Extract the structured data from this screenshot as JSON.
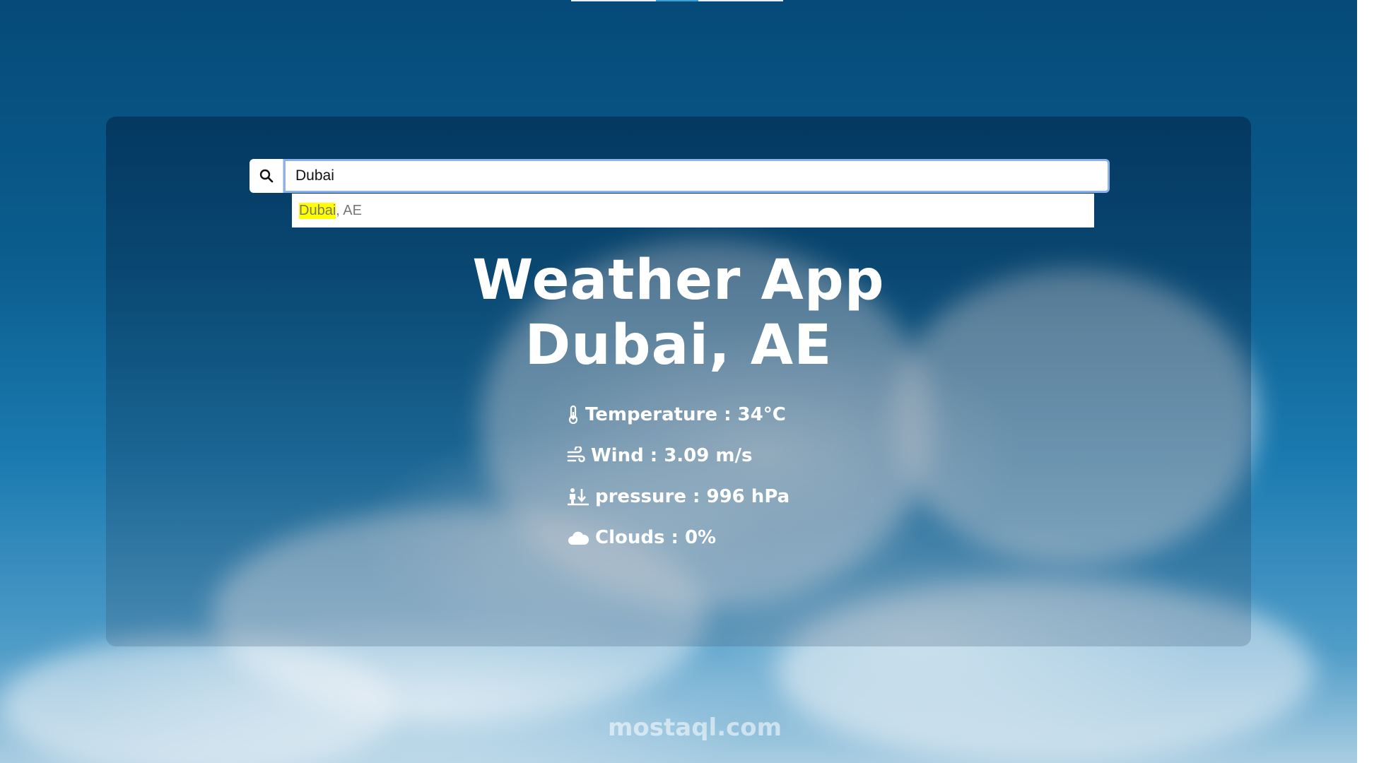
{
  "search": {
    "value": "Dubai",
    "suggestion_match": "Dubai",
    "suggestion_rest": ", AE"
  },
  "header": {
    "app_title": "Weather App",
    "city": "Dubai, AE"
  },
  "stats": [
    {
      "icon": "thermometer-icon",
      "label": "Temperature : 34°C"
    },
    {
      "icon": "wind-icon",
      "label": "Wind : 3.09 m/s"
    },
    {
      "icon": "pressure-icon",
      "label": "pressure : 996 hPa"
    },
    {
      "icon": "cloud-icon",
      "label": "Clouds : 0%"
    }
  ],
  "watermark": "mostaql.com",
  "colors": {
    "highlight": "#ffff00",
    "focus_border": "#8fb3e8"
  }
}
